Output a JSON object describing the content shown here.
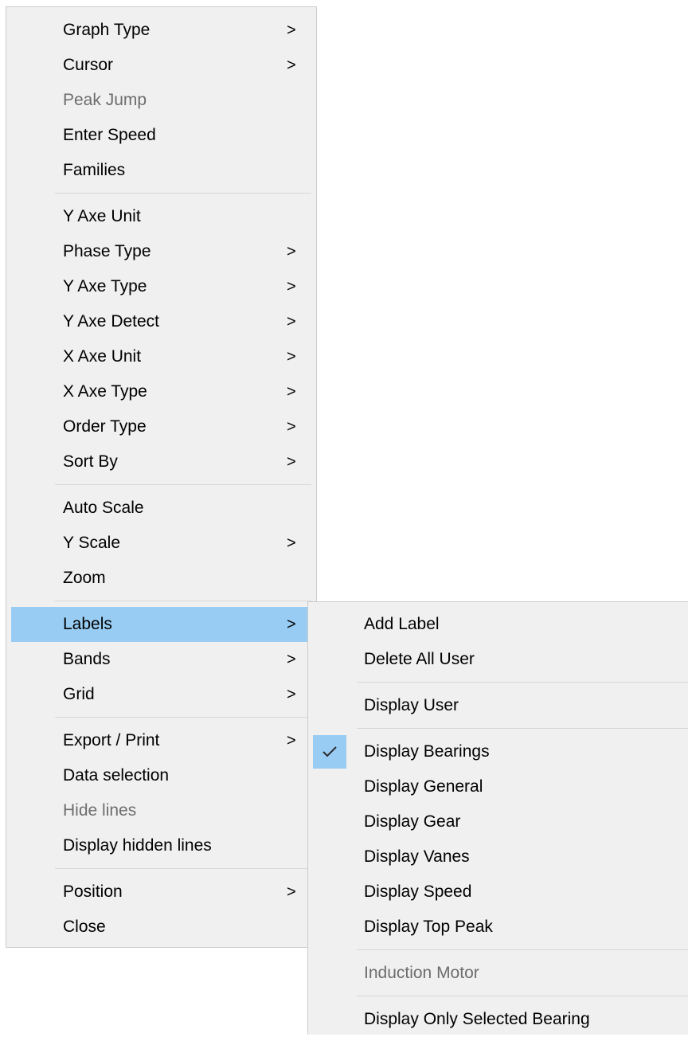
{
  "main_menu": {
    "graph_type": "Graph Type",
    "cursor": "Cursor",
    "peak_jump": "Peak Jump",
    "enter_speed": "Enter Speed",
    "families": "Families",
    "y_axe_unit": "Y Axe Unit",
    "phase_type": "Phase Type",
    "y_axe_type": "Y Axe Type",
    "y_axe_detect": "Y Axe Detect",
    "x_axe_unit": "X Axe Unit",
    "x_axe_type": "X Axe Type",
    "order_type": "Order Type",
    "sort_by": "Sort By",
    "auto_scale": "Auto Scale",
    "y_scale": "Y Scale",
    "zoom": "Zoom",
    "labels": "Labels",
    "bands": "Bands",
    "grid": "Grid",
    "export_print": "Export / Print",
    "data_selection": "Data selection",
    "hide_lines": "Hide lines",
    "display_hidden_lines": "Display hidden lines",
    "position": "Position",
    "close": "Close",
    "arrow": ">"
  },
  "labels_submenu": {
    "add_label": "Add Label",
    "delete_all_user": "Delete All User",
    "display_user": "Display User",
    "display_bearings": "Display Bearings",
    "display_general": "Display General",
    "display_gear": "Display Gear",
    "display_vanes": "Display Vanes",
    "display_speed": "Display Speed",
    "display_top_peak": "Display Top Peak",
    "induction_motor": "Induction Motor",
    "display_only_selected_bearing": "Display Only Selected Bearing"
  },
  "colors": {
    "menu_background": "#f0f0f0",
    "highlight": "#99ccf3",
    "disabled_text": "#6d6d6d"
  }
}
